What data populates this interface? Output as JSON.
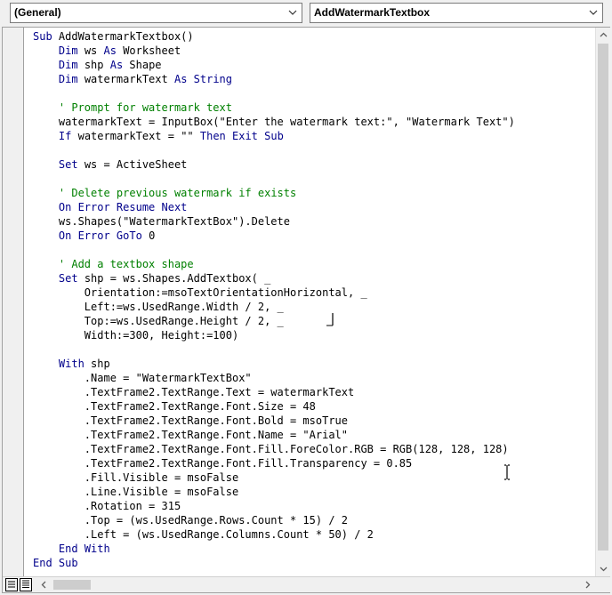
{
  "object_dropdown": {
    "value": "(General)",
    "icon": "chevron-down-icon"
  },
  "procedure_dropdown": {
    "value": "AddWatermarkTextbox",
    "icon": "chevron-down-icon"
  },
  "colors": {
    "keyword": "#00008b",
    "comment": "#008000",
    "text": "#000000"
  },
  "code_lines": [
    [
      {
        "t": "Sub ",
        "c": "kw"
      },
      {
        "t": "AddWatermarkTextbox()"
      }
    ],
    [
      {
        "t": "    "
      },
      {
        "t": "Dim ",
        "c": "kw"
      },
      {
        "t": "ws "
      },
      {
        "t": "As ",
        "c": "kw"
      },
      {
        "t": "Worksheet"
      }
    ],
    [
      {
        "t": "    "
      },
      {
        "t": "Dim ",
        "c": "kw"
      },
      {
        "t": "shp "
      },
      {
        "t": "As ",
        "c": "kw"
      },
      {
        "t": "Shape"
      }
    ],
    [
      {
        "t": "    "
      },
      {
        "t": "Dim ",
        "c": "kw"
      },
      {
        "t": "watermarkText "
      },
      {
        "t": "As String",
        "c": "kw"
      }
    ],
    [
      {
        "t": ""
      }
    ],
    [
      {
        "t": "    "
      },
      {
        "t": "' Prompt for watermark text",
        "c": "cm"
      }
    ],
    [
      {
        "t": "    watermarkText = InputBox(\"Enter the watermark text:\", \"Watermark Text\")"
      }
    ],
    [
      {
        "t": "    "
      },
      {
        "t": "If ",
        "c": "kw"
      },
      {
        "t": "watermarkText = \"\" "
      },
      {
        "t": "Then Exit Sub",
        "c": "kw"
      }
    ],
    [
      {
        "t": ""
      }
    ],
    [
      {
        "t": "    "
      },
      {
        "t": "Set ",
        "c": "kw"
      },
      {
        "t": "ws = ActiveSheet"
      }
    ],
    [
      {
        "t": ""
      }
    ],
    [
      {
        "t": "    "
      },
      {
        "t": "' Delete previous watermark if exists",
        "c": "cm"
      }
    ],
    [
      {
        "t": "    "
      },
      {
        "t": "On Error Resume Next",
        "c": "kw"
      }
    ],
    [
      {
        "t": "    ws.Shapes(\"WatermarkTextBox\").Delete"
      }
    ],
    [
      {
        "t": "    "
      },
      {
        "t": "On Error GoTo ",
        "c": "kw"
      },
      {
        "t": "0"
      }
    ],
    [
      {
        "t": ""
      }
    ],
    [
      {
        "t": "    "
      },
      {
        "t": "' Add a textbox shape",
        "c": "cm"
      }
    ],
    [
      {
        "t": "    "
      },
      {
        "t": "Set ",
        "c": "kw"
      },
      {
        "t": "shp = ws.Shapes.AddTextbox( _"
      }
    ],
    [
      {
        "t": "        Orientation:=msoTextOrientationHorizontal, _"
      }
    ],
    [
      {
        "t": "        Left:=ws.UsedRange.Width / 2, _"
      }
    ],
    [
      {
        "t": "        Top:=ws.UsedRange.Height / 2, _"
      }
    ],
    [
      {
        "t": "        Width:=300, Height:=100)"
      }
    ],
    [
      {
        "t": ""
      }
    ],
    [
      {
        "t": "    "
      },
      {
        "t": "With ",
        "c": "kw"
      },
      {
        "t": "shp"
      }
    ],
    [
      {
        "t": "        .Name = \"WatermarkTextBox\""
      }
    ],
    [
      {
        "t": "        .TextFrame2.TextRange.Text = watermarkText"
      }
    ],
    [
      {
        "t": "        .TextFrame2.TextRange.Font.Size = 48"
      }
    ],
    [
      {
        "t": "        .TextFrame2.TextRange.Font.Bold = msoTrue"
      }
    ],
    [
      {
        "t": "        .TextFrame2.TextRange.Font.Name = \"Arial\""
      }
    ],
    [
      {
        "t": "        .TextFrame2.TextRange.Font.Fill.ForeColor.RGB = RGB(128, 128, 128)"
      }
    ],
    [
      {
        "t": "        .TextFrame2.TextRange.Font.Fill.Transparency = 0.85"
      }
    ],
    [
      {
        "t": "        .Fill.Visible = msoFalse"
      }
    ],
    [
      {
        "t": "        .Line.Visible = msoFalse"
      }
    ],
    [
      {
        "t": "        .Rotation = 315"
      }
    ],
    [
      {
        "t": "        .Top = (ws.UsedRange.Rows.Count * 15) / 2"
      }
    ],
    [
      {
        "t": "        .Left = (ws.UsedRange.Columns.Count * 50) / 2"
      }
    ],
    [
      {
        "t": "    "
      },
      {
        "t": "End With",
        "c": "kw"
      }
    ],
    [
      {
        "t": "End Sub",
        "c": "kw"
      }
    ]
  ]
}
